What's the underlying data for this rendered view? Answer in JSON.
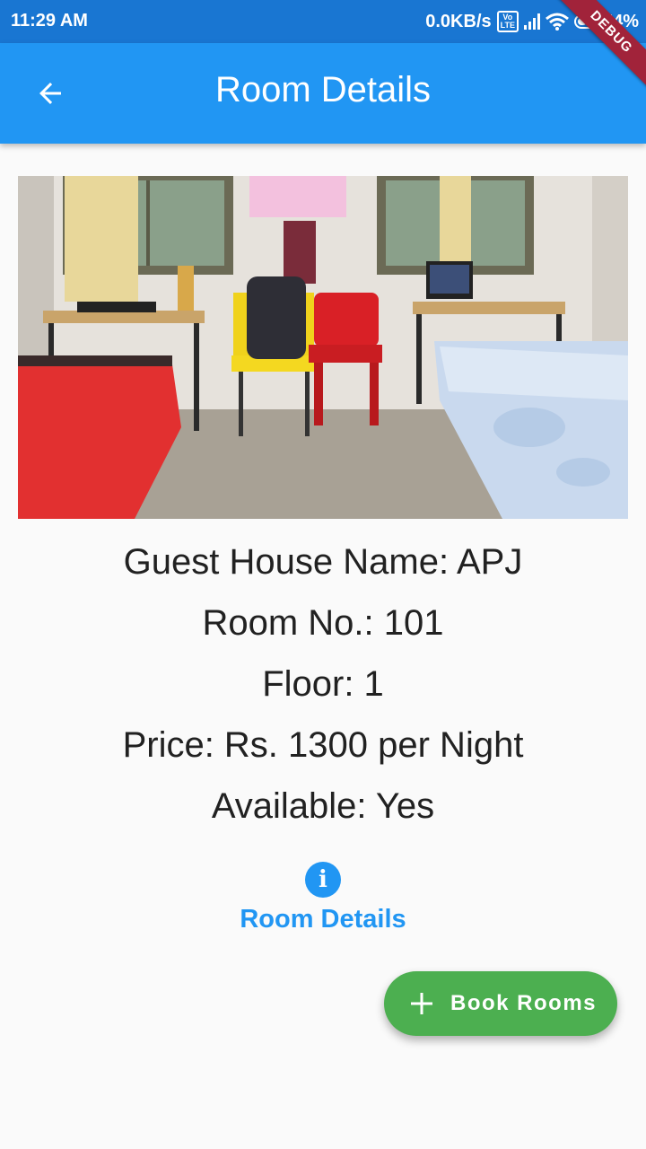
{
  "status_bar": {
    "time": "11:29 AM",
    "network_speed": "0.0KB/s",
    "volte_label": "Vo\nLTE",
    "battery": "54%",
    "icons": [
      "volte-icon",
      "signal-icon",
      "wifi-icon",
      "battery-icon"
    ]
  },
  "app_bar": {
    "title": "Room Details",
    "back_icon": "arrow-back-icon"
  },
  "debug_banner": "DEBUG",
  "room": {
    "photo_icon": "room-photo",
    "guest_house": "Guest House Name: APJ",
    "room_no": "Room No.: 101",
    "floor": "Floor: 1",
    "price": "Price: Rs. 1300 per Night",
    "available": "Available: Yes"
  },
  "tab": {
    "icon": "info-icon",
    "icon_glyph": "i",
    "label": "Room Details"
  },
  "fab": {
    "icon": "plus-icon",
    "label": "Book Rooms"
  },
  "colors": {
    "status_bar": "#1976d2",
    "app_bar": "#2196f3",
    "accent": "#2196f3",
    "fab": "#4caf50",
    "debug": "#a1233a"
  }
}
